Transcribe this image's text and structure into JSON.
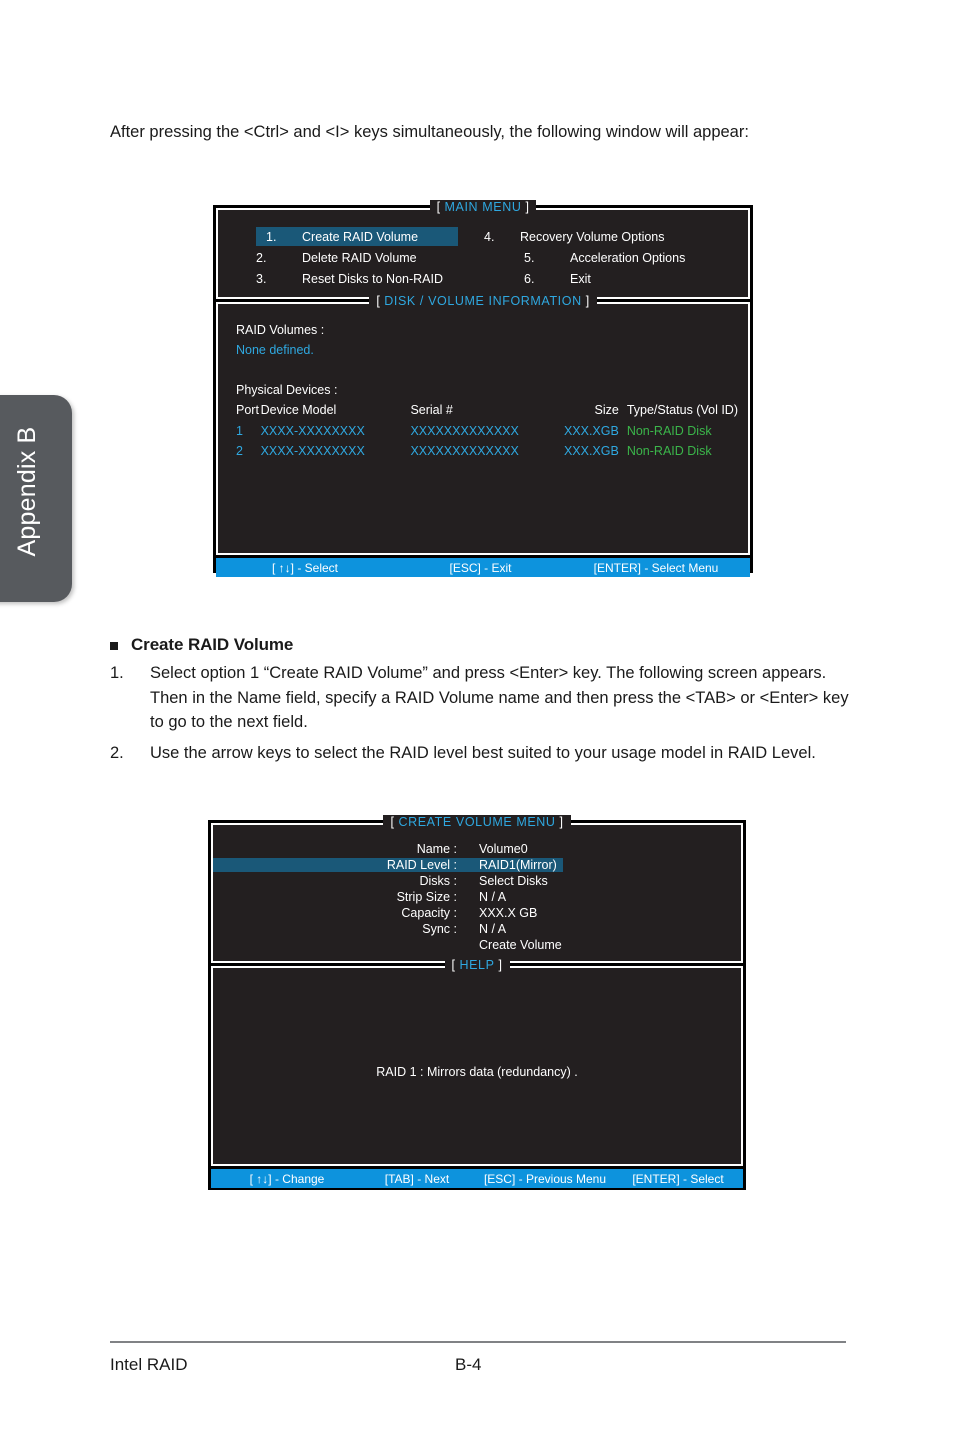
{
  "sidebar": {
    "tab_label": "Appendix B"
  },
  "intro": {
    "paragraph": "After pressing the <Ctrl> and <I> keys simultaneously, the following window will appear:"
  },
  "bios_main": {
    "title_open": "[",
    "title": "MAIN  MENU",
    "title_close": "]",
    "menu_items": [
      {
        "num": "1.",
        "label": "Create  RAID  Volume",
        "selected": true
      },
      {
        "num": "2.",
        "label": "Delete  RAID  Volume",
        "selected": false
      },
      {
        "num": "3.",
        "label": "Reset Disks to Non-RAID",
        "selected": false
      },
      {
        "num": "4.",
        "label": "Recovery Volume  Options",
        "selected": false
      },
      {
        "num": "5.",
        "label": "Acceleration Options",
        "selected": false
      },
      {
        "num": "6.",
        "label": "Exit",
        "selected": false
      }
    ],
    "info_title_open": "[",
    "info_title": "DISK / VOLUME INFORMATION",
    "info_title_close": "]",
    "raid_volumes_label": "RAID  Volumes :",
    "raid_volumes_value": "None  defined.",
    "physical_devices_label": "Physical  Devices :",
    "columns": [
      "Port",
      "Device  Model",
      "Serial  #",
      "Size",
      "Type/Status (Vol  ID)"
    ],
    "devices": [
      {
        "port": "1",
        "model": "XXXX-XXXXXXXX",
        "serial": "XXXXXXXXXXXXX",
        "size": "XXX.XGB",
        "type": "Non-RAID  Disk"
      },
      {
        "port": "2",
        "model": "XXXX-XXXXXXXX",
        "serial": "XXXXXXXXXXXXX",
        "size": "XXX.XGB",
        "type": "Non-RAID  Disk"
      }
    ],
    "statusbar": [
      "[ ↑↓] - Select",
      "[ESC] - Exit",
      "[ENTER] - Select Menu"
    ]
  },
  "section_create": {
    "heading": "Create RAID Volume",
    "steps": [
      {
        "n": "1.",
        "text": "Select option 1 “Create RAID Volume” and press <Enter> key. The following screen appears. Then in the Name field, specify a RAID Volume name and then press the <TAB> or <Enter> key to go to the next field."
      },
      {
        "n": "2.",
        "text": "Use the arrow keys to select the RAID level best suited to your usage model in RAID Level."
      }
    ]
  },
  "bios_create": {
    "title_open": "[",
    "title": "CREATE VOLUME MENU",
    "title_close": "]",
    "fields": [
      {
        "key": "Name :",
        "value": "Volume0",
        "selected": false
      },
      {
        "key": "RAID Level :",
        "value": "RAID1(Mirror)",
        "selected": true
      },
      {
        "key": "Disks :",
        "value": "Select  Disks",
        "selected": false
      },
      {
        "key": "Strip Size :",
        "value": "N / A",
        "selected": false
      },
      {
        "key": "Capacity :",
        "value": "XXX.X  GB",
        "selected": false
      },
      {
        "key": "Sync :",
        "value": "N / A",
        "selected": false
      },
      {
        "key": "",
        "value": "Create Volume",
        "selected": false
      }
    ],
    "help_title_open": "[",
    "help_title": "HELP",
    "help_title_close": "]",
    "help_text": "RAID  1 : Mirrors  data  (redundancy) .",
    "statusbar": [
      "[ ↑↓] - Change",
      "[TAB] - Next",
      "[ESC] - Previous Menu",
      "[ENTER] - Select"
    ]
  },
  "footer": {
    "left": "Intel RAID",
    "page": "B-4"
  },
  "colors": {
    "accent_blue": "#2fa8e0",
    "statusbar_blue": "#0d93dd",
    "highlight_blue": "#1a5878",
    "status_green": "#3bb54a",
    "screen_bg": "#231f20",
    "tab_gray": "#575a5e"
  }
}
